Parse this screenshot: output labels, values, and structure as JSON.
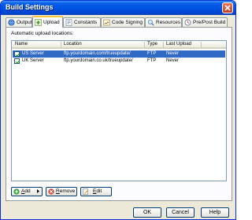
{
  "window": {
    "title": "Build Settings",
    "close_icon": "close-icon"
  },
  "tabs": [
    {
      "label": "Output",
      "icon": "output-icon",
      "active": false
    },
    {
      "label": "Upload",
      "icon": "upload-icon",
      "active": true
    },
    {
      "label": "Constants",
      "icon": "constants-icon",
      "active": false
    },
    {
      "label": "Code Signing",
      "icon": "code-signing-icon",
      "active": false
    },
    {
      "label": "Resources",
      "icon": "resources-icon",
      "active": false
    },
    {
      "label": "Pre/Post Build",
      "icon": "pre-post-build-icon",
      "active": false
    }
  ],
  "upload": {
    "group_label": "Automatic upload locations:",
    "columns": [
      "Name",
      "Location",
      "Type",
      "Last Upload"
    ],
    "rows": [
      {
        "checked": true,
        "name": "US Server",
        "location": "ftp.yourdomain.com/trueupdate/",
        "type": "FTP",
        "last_upload": "Never",
        "selected": true
      },
      {
        "checked": true,
        "name": "UK Server",
        "location": "ftp.yourdomain.co.uk/trueupdate/",
        "type": "FTP",
        "last_upload": "Never",
        "selected": false
      }
    ],
    "add_button": {
      "label": "Add",
      "mnemonic": "A",
      "rest": "dd"
    },
    "remove_button": {
      "label": "Remove",
      "mnemonic": "R",
      "rest": "emove"
    },
    "edit_button": {
      "label": "Edit",
      "mnemonic": "E",
      "rest": "dit"
    }
  },
  "dialog_buttons": {
    "ok": "OK",
    "cancel": "Cancel",
    "help": "Help"
  },
  "colors": {
    "title_bar": "#0054e3",
    "selection": "#316ac5",
    "dialog_bg": "#ece9d8",
    "tab_highlight": "#ffc83c"
  }
}
